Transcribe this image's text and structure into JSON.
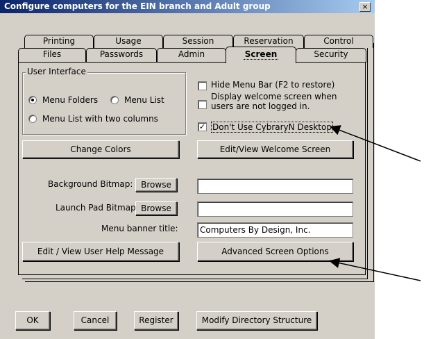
{
  "window": {
    "title": "Configure computers for the EIN branch and Adult group",
    "close_label": "×"
  },
  "tabs_back": [
    "Printing",
    "Usage",
    "Session",
    "Reservation",
    "Control"
  ],
  "tabs_front": [
    "Files",
    "Passwords",
    "Admin",
    "Screen",
    "Security"
  ],
  "active_tab": "Screen",
  "user_interface": {
    "group_label": "User Interface",
    "options": [
      {
        "label": "Menu Folders",
        "selected": true
      },
      {
        "label": "Menu List",
        "selected": false
      },
      {
        "label": "Menu List with two columns",
        "selected": false
      }
    ]
  },
  "checkboxes": {
    "hide_menu_bar": {
      "label": "Hide Menu Bar (F2 to restore)",
      "checked": false
    },
    "display_welcome_line1": "Display welcome screen when",
    "display_welcome_line2": "users are not logged in.",
    "display_welcome_checked": false,
    "dont_use_desktop": {
      "label": "Don't Use CybraryN Desktop",
      "checked": true,
      "mark": "✓"
    }
  },
  "buttons": {
    "change_colors": "Change Colors",
    "edit_welcome": "Edit/View Welcome Screen",
    "browse_background": "Browse",
    "browse_launch": "Browse",
    "edit_help": "Edit / View User Help Message",
    "advanced_screen": "Advanced Screen Options"
  },
  "fields": {
    "background_label": "Background Bitmap:",
    "background_value": "",
    "launch_label": "Launch Pad Bitmap:",
    "launch_value": "",
    "banner_label": "Menu banner title:",
    "banner_value": "Computers By Design, Inc."
  },
  "footer": {
    "ok": "OK",
    "cancel": "Cancel",
    "register": "Register",
    "modify": "Modify Directory Structure"
  }
}
